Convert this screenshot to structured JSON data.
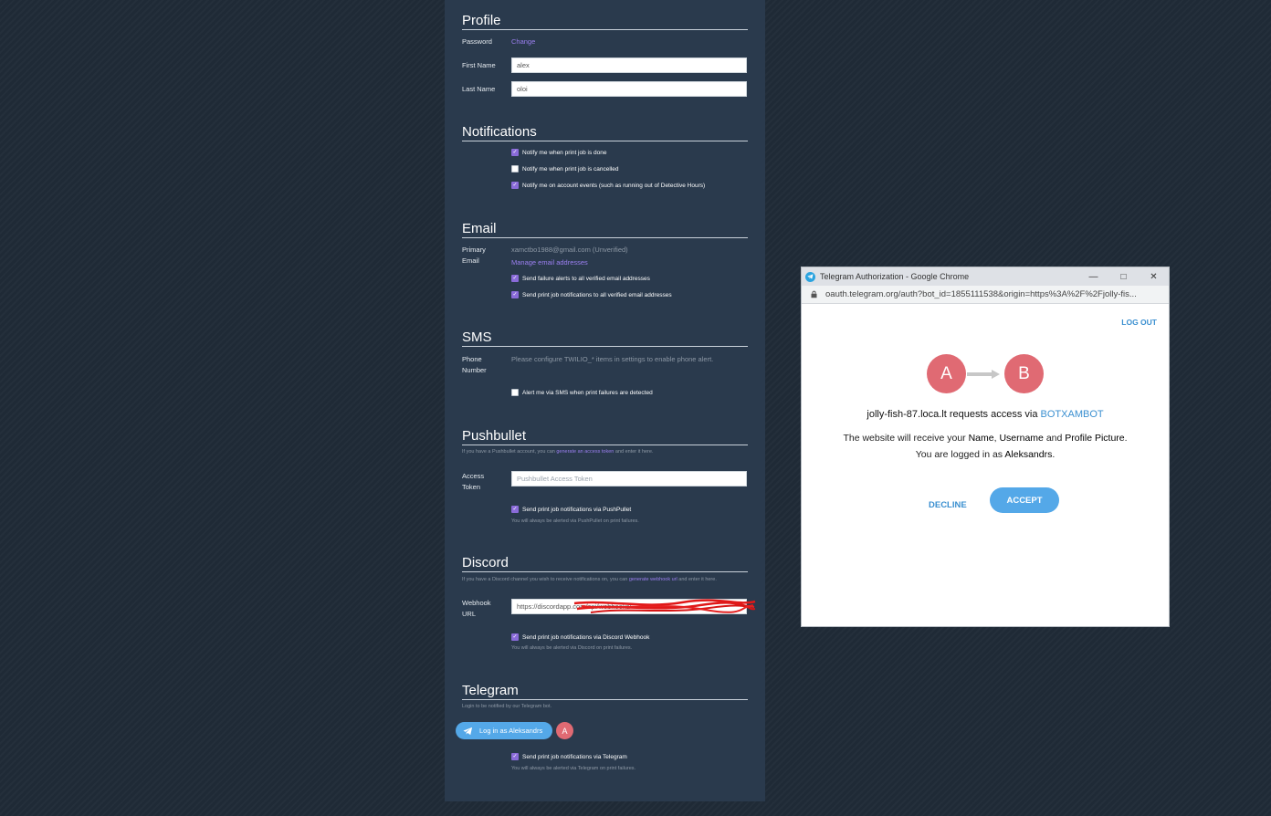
{
  "profile": {
    "title": "Profile",
    "password_label": "Password",
    "password_link": "Change",
    "first_name_label": "First Name",
    "first_name_value": "alex",
    "last_name_label": "Last Name",
    "last_name_value": "oloi"
  },
  "notifications": {
    "title": "Notifications",
    "items": [
      {
        "label": "Notify me when print job is done",
        "checked": true
      },
      {
        "label": "Notify me when print job is cancelled",
        "checked": false
      },
      {
        "label": "Notify me on account events (such as running out of Detective Hours)",
        "checked": true
      }
    ]
  },
  "email": {
    "title": "Email",
    "primary_label_1": "Primary",
    "primary_label_2": "Email",
    "address": "xamctbo1988@gmail.com (Unverified)",
    "manage_link": "Manage email addresses",
    "items": [
      {
        "label": "Send failure alerts to all verified email addresses",
        "checked": true
      },
      {
        "label": "Send print job notifications to all verified email addresses",
        "checked": true
      }
    ]
  },
  "sms": {
    "title": "SMS",
    "phone_label_1": "Phone",
    "phone_label_2": "Number",
    "configure_text": "Please configure TWILIO_* items in settings to enable phone alert.",
    "alert_label": "Alert me via SMS when print failures are detected",
    "alert_checked": false
  },
  "pushbullet": {
    "title": "Pushbullet",
    "desc_before": "If you have a Pushbullet account, you can",
    "desc_link": "generate an access token",
    "desc_after": "and enter it here.",
    "token_label_1": "Access",
    "token_label_2": "Token",
    "token_placeholder": "Pushbullet Access Token",
    "notify_label": "Send print job notifications via PushPullet",
    "notify_checked": true,
    "hint": "You will always be alerted via PushPullet on print failures."
  },
  "discord": {
    "title": "Discord",
    "desc_before": "If you have a Discord channel you wish to receive notifications on, you can",
    "desc_link": "generate webhook url",
    "desc_after": "and enter it here.",
    "webhook_label_1": "Webhook",
    "webhook_label_2": "URL",
    "webhook_value": "https://discordapp.com/api/webhooks/",
    "notify_label": "Send print job notifications via Discord Webhook",
    "notify_checked": true,
    "hint": "You will always be alerted via Discord on print failures."
  },
  "telegram": {
    "title": "Telegram",
    "desc": "Login to be notified by our Telegram bot.",
    "login_button": "Log in as Aleksandrs",
    "avatar_letter": "A",
    "notify_label": "Send print job notifications via Telegram",
    "notify_checked": true,
    "hint": "You will always be alerted via Telegram on print failures."
  },
  "popup": {
    "window_title": "Telegram Authorization - Google Chrome",
    "url": "oauth.telegram.org/auth?bot_id=1855111538&origin=https%3A%2F%2Fjolly-fis...",
    "logout": "LOG OUT",
    "circle_a": "A",
    "circle_b": "B",
    "request_site": "jolly-fish-87.loca.lt requests access via",
    "bot_name": "BOTXAMBOT",
    "info_1": "The website will receive your",
    "info_name": "Name",
    "info_comma": ",",
    "info_username": "Username",
    "info_and": "and",
    "info_picture": "Profile Picture",
    "info_period": ".",
    "logged_in_prefix": "You are logged in as",
    "logged_in_user": "Aleksandrs",
    "decline": "DECLINE",
    "accept": "ACCEPT"
  },
  "colors": {
    "background": "#1f2a36",
    "panel": "#2a3a4d",
    "accent_purple": "#8a6bd9",
    "telegram_blue": "#54a8e8",
    "avatar_red": "#e06a73"
  }
}
